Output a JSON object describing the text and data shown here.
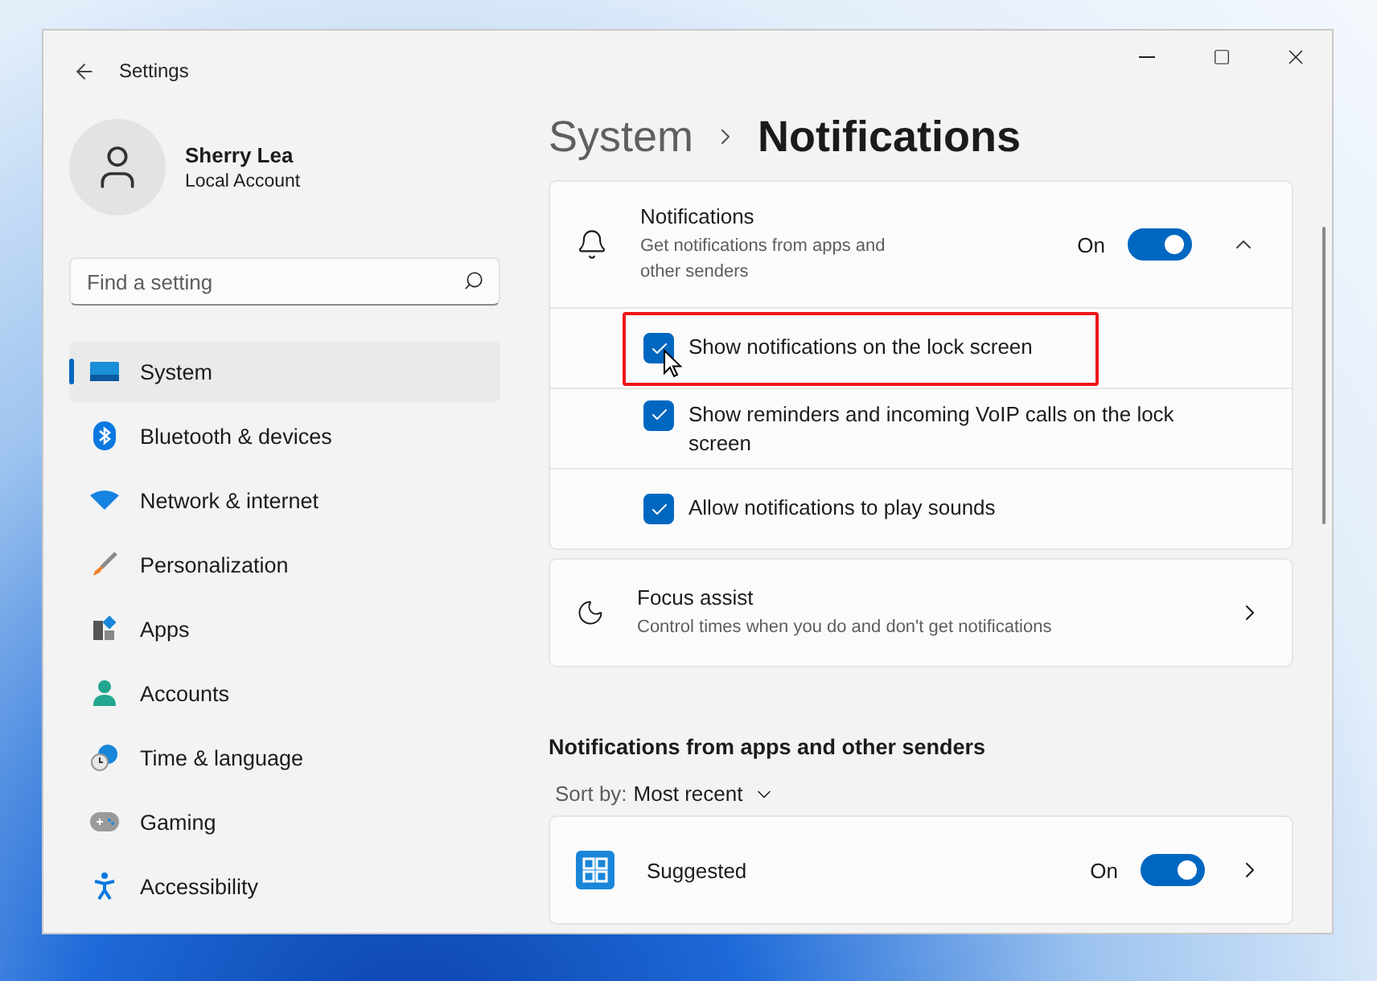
{
  "window": {
    "title": "Settings"
  },
  "profile": {
    "name": "Sherry Lea",
    "account": "Local Account"
  },
  "search": {
    "placeholder": "Find a setting"
  },
  "sidebar": {
    "items": [
      {
        "label": "System",
        "selected": true
      },
      {
        "label": "Bluetooth & devices",
        "selected": false
      },
      {
        "label": "Network & internet",
        "selected": false
      },
      {
        "label": "Personalization",
        "selected": false
      },
      {
        "label": "Apps",
        "selected": false
      },
      {
        "label": "Accounts",
        "selected": false
      },
      {
        "label": "Time & language",
        "selected": false
      },
      {
        "label": "Gaming",
        "selected": false
      },
      {
        "label": "Accessibility",
        "selected": false
      }
    ]
  },
  "breadcrumb": {
    "parent": "System",
    "current": "Notifications"
  },
  "notifications_card": {
    "title": "Notifications",
    "description": "Get notifications from apps and other senders",
    "toggle_label": "On",
    "on": true,
    "expanded": true,
    "options": [
      {
        "label": "Show notifications on the lock screen",
        "checked": true,
        "highlighted": true
      },
      {
        "label": "Show reminders and incoming VoIP calls on the lock screen",
        "checked": true,
        "highlighted": false
      },
      {
        "label": "Allow notifications to play sounds",
        "checked": true,
        "highlighted": false
      }
    ]
  },
  "focus_assist": {
    "title": "Focus assist",
    "description": "Control times when you do and don't get notifications"
  },
  "apps_section": {
    "heading": "Notifications from apps and other senders",
    "sort_label": "Sort by:",
    "sort_value": "Most recent",
    "apps": [
      {
        "name": "Suggested",
        "toggle_label": "On",
        "on": true
      }
    ]
  }
}
